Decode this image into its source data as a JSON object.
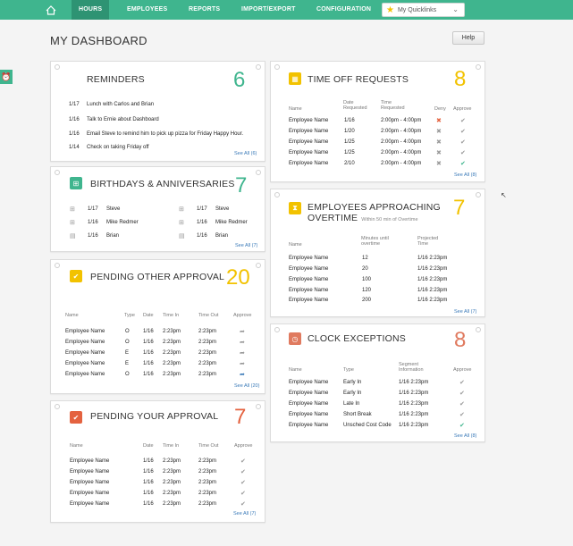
{
  "nav": {
    "items": [
      "Hours",
      "Employees",
      "Reports",
      "Import/Export",
      "Configuration"
    ],
    "quicklinks": "My Quicklinks"
  },
  "page": {
    "title": "MY DASHBOARD",
    "help": "Help"
  },
  "colors": {
    "primary": "#3fb58e",
    "yellow": "#f2c200",
    "red": "#e4623f",
    "orange": "#e07a5f",
    "blue": "#3a7ab8"
  },
  "reminders": {
    "title": "REMINDERS",
    "count": "6",
    "see_all": "See All (6)",
    "items": [
      {
        "date": "1/17",
        "text": "Lunch with Carlos and Brian"
      },
      {
        "date": "1/16",
        "text": "Talk to Ernie about Dashboard"
      },
      {
        "date": "1/16",
        "text": "Email Steve to remind him to pick up pizza for Friday Happy Hour."
      },
      {
        "date": "1/14",
        "text": "Check on taking Friday off"
      }
    ]
  },
  "birthdays": {
    "title": "BIRTHDAYS & ANNIVERSARIES",
    "count": "7",
    "see_all": "See All (7)",
    "left": [
      {
        "icon": "gift-icon",
        "date": "1/17",
        "name": "Steve"
      },
      {
        "icon": "gift-icon",
        "date": "1/16",
        "name": "Mike Redmer"
      },
      {
        "icon": "calendar-icon",
        "date": "1/16",
        "name": "Brian"
      }
    ],
    "right": [
      {
        "icon": "gift-icon",
        "date": "1/17",
        "name": "Steve"
      },
      {
        "icon": "gift-icon",
        "date": "1/16",
        "name": "Mike Redmer"
      },
      {
        "icon": "calendar-icon",
        "date": "1/16",
        "name": "Brian"
      }
    ]
  },
  "other_approval": {
    "title": "PENDING OTHER APPROVAL",
    "count": "20",
    "see_all": "See All (20)",
    "headers": [
      "Name",
      "Type",
      "Date",
      "Time In",
      "Time Out",
      "Approve"
    ],
    "rows": [
      {
        "name": "Employee Name",
        "type": "O",
        "date": "1/16",
        "in": "2:23pm",
        "out": "2:23pm",
        "icon": "grey"
      },
      {
        "name": "Employee Name",
        "type": "O",
        "date": "1/16",
        "in": "2:23pm",
        "out": "2:23pm",
        "icon": "grey"
      },
      {
        "name": "Employee Name",
        "type": "E",
        "date": "1/16",
        "in": "2:23pm",
        "out": "2:23pm",
        "icon": "grey"
      },
      {
        "name": "Employee Name",
        "type": "E",
        "date": "1/16",
        "in": "2:23pm",
        "out": "2:23pm",
        "icon": "grey"
      },
      {
        "name": "Employee Name",
        "type": "O",
        "date": "1/16",
        "in": "2:23pm",
        "out": "2:23pm",
        "icon": "blue"
      }
    ]
  },
  "your_approval": {
    "title": "PENDING YOUR APPROVAL",
    "count": "7",
    "see_all": "See All (7)",
    "headers": [
      "Name",
      "Date",
      "Time In",
      "Time Out",
      "Approve"
    ],
    "rows": [
      {
        "name": "Employee Name",
        "date": "1/16",
        "in": "2:23pm",
        "out": "2:23pm"
      },
      {
        "name": "Employee Name",
        "date": "1/16",
        "in": "2:23pm",
        "out": "2:23pm"
      },
      {
        "name": "Employee Name",
        "date": "1/16",
        "in": "2:23pm",
        "out": "2:23pm"
      },
      {
        "name": "Employee Name",
        "date": "1/16",
        "in": "2:23pm",
        "out": "2:23pm"
      },
      {
        "name": "Employee Name",
        "date": "1/16",
        "in": "2:23pm",
        "out": "2:23pm"
      }
    ]
  },
  "time_off": {
    "title": "TIME OFF REQUESTS",
    "count": "8",
    "see_all": "See All (8)",
    "headers": {
      "name": "Name",
      "date": "Date Requested",
      "time": "Time Requested",
      "deny": "Deny",
      "approve": "Approve"
    },
    "rows": [
      {
        "name": "Employee Name",
        "date": "1/16",
        "time": "2:00pm - 4:00pm",
        "deny": "red",
        "approve": "grey"
      },
      {
        "name": "Employee Name",
        "date": "1/20",
        "time": "2:00pm - 4:00pm",
        "deny": "grey",
        "approve": "grey"
      },
      {
        "name": "Employee Name",
        "date": "1/25",
        "time": "2:00pm - 4:00pm",
        "deny": "grey",
        "approve": "grey"
      },
      {
        "name": "Employee Name",
        "date": "1/25",
        "time": "2:00pm - 4:00pm",
        "deny": "grey",
        "approve": "grey"
      },
      {
        "name": "Employee Name",
        "date": "2/10",
        "time": "2:00pm - 4:00pm",
        "deny": "grey",
        "approve": "green"
      }
    ]
  },
  "overtime": {
    "title": "EMPLOYEES APPROACHING",
    "title2": "OVERTIME",
    "sub": "Within 50 min of Overtime",
    "count": "7",
    "see_all": "See All (7)",
    "headers": {
      "name": "Name",
      "minutes": "Minutes until overtime",
      "projected": "Projected Time"
    },
    "rows": [
      {
        "name": "Employee Name",
        "minutes": "12",
        "time": "1/16 2:23pm"
      },
      {
        "name": "Employee Name",
        "minutes": "20",
        "time": "1/16 2:23pm"
      },
      {
        "name": "Employee Name",
        "minutes": "100",
        "time": "1/16 2:23pm"
      },
      {
        "name": "Employee Name",
        "minutes": "120",
        "time": "1/16 2:23pm"
      },
      {
        "name": "Employee Name",
        "minutes": "200",
        "time": "1/16 2:23pm"
      }
    ]
  },
  "exceptions": {
    "title": "CLOCK EXCEPTIONS",
    "count": "8",
    "see_all": "See All (8)",
    "headers": {
      "name": "Name",
      "type": "Type",
      "segment": "Segment Information",
      "approve": "Approve"
    },
    "rows": [
      {
        "name": "Employee Name",
        "type": "Early In",
        "segment": "1/16 2:23pm",
        "approve": "grey"
      },
      {
        "name": "Employee Name",
        "type": "Early In",
        "segment": "1/16 2:23pm",
        "approve": "grey"
      },
      {
        "name": "Employee Name",
        "type": "Late In",
        "segment": "1/16 2:23pm",
        "approve": "grey"
      },
      {
        "name": "Employee Name",
        "type": "Short Break",
        "segment": "1/16 2:23pm",
        "approve": "grey"
      },
      {
        "name": "Employee Name",
        "type": "Unsched Cost Code",
        "segment": "1/16 2:23pm",
        "approve": "green"
      }
    ]
  }
}
